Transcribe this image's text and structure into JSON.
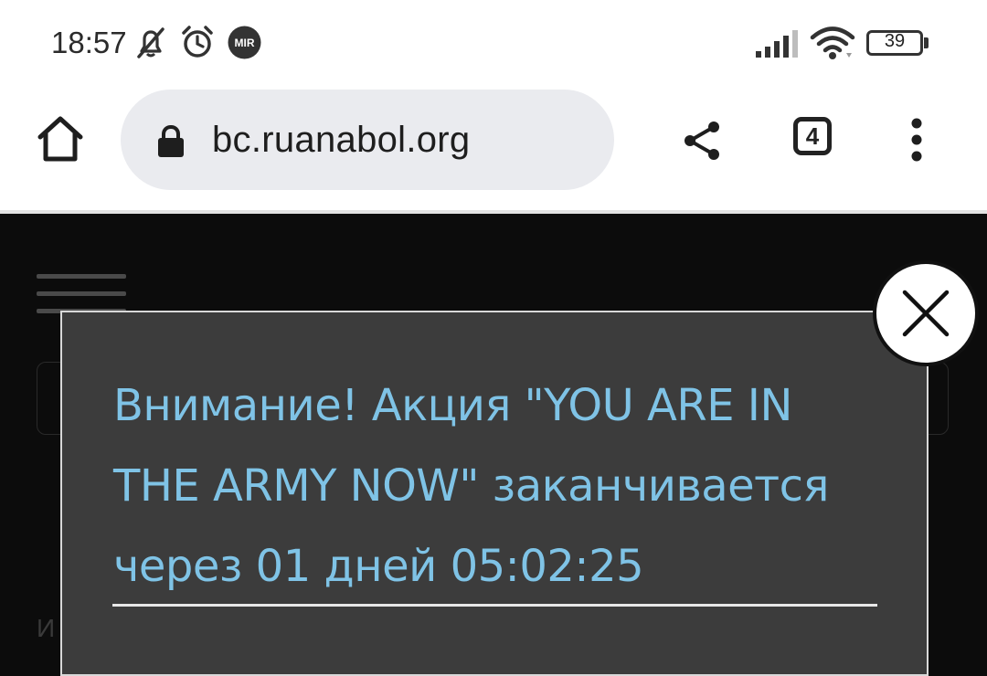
{
  "status_bar": {
    "time": "18:57",
    "battery_level": "39",
    "icons": [
      "bell-off-icon",
      "alarm-icon",
      "mir-icon",
      "signal-icon",
      "wifi-icon",
      "battery-icon"
    ],
    "mir_label": "MIR"
  },
  "browser": {
    "url": "bc.ruanabol.org",
    "tab_count": "4",
    "icons": [
      "home-icon",
      "lock-icon",
      "share-icon",
      "menu-dots-icon"
    ]
  },
  "modal": {
    "line1": "Внимание! Акция \"YOU ARE IN",
    "line2": "THE ARMY NOW\" заканчивается",
    "line3": "через 01 дней 05:02:25",
    "text_color": "#7fc3e6"
  },
  "page": {
    "partial_letter": "И"
  }
}
